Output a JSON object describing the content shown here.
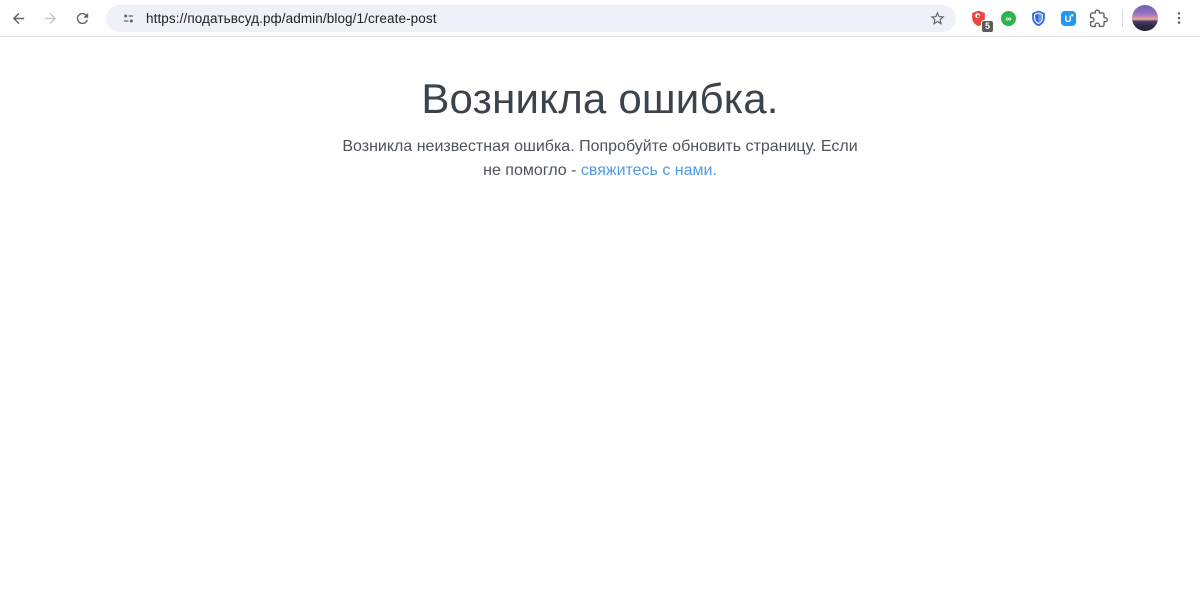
{
  "browser": {
    "url": "https://податьвсуд.рф/admin/blog/1/create-post",
    "icons": {
      "back": "arrow-left",
      "forward": "arrow-right",
      "reload": "refresh",
      "site_info": "site-controls-toggles",
      "bookmark": "star-outline",
      "extensions_menu": "puzzle-piece",
      "profile": "photo-avatar-sunset-landscape",
      "menu": "kebab-three-dots"
    },
    "extensions": [
      {
        "name": "red-shield-adblocker",
        "badge": "5",
        "color": "#e8483e",
        "badge_color": "#5b5b5b"
      },
      {
        "name": "green-infinity",
        "glyph": "∞",
        "color": "#31b34c"
      },
      {
        "name": "blue-shield-bitwarden",
        "color": "#2d6ae3"
      },
      {
        "name": "blue-u-square",
        "glyph": "U",
        "color": "#2196f3"
      },
      {
        "name": "extensions-puzzle",
        "color": "#5f6368"
      }
    ],
    "colors": {
      "omnibox_bg": "#eef1f8",
      "toolbar_bg": "#ffffff",
      "toolbar_border": "#dee1e6",
      "icon_gray": "#5f6368"
    }
  },
  "page": {
    "title": "Возникла ошибка.",
    "message_line1": "Возникла неизвестная ошибка. Попробуйте обновить страницу. Если",
    "message_line2_prefix": "не помогло - ",
    "contact_link": "свяжитесь с нами.",
    "colors": {
      "title": "#3d434b",
      "body_text": "#4c535a",
      "link": "#4d9be6"
    }
  }
}
